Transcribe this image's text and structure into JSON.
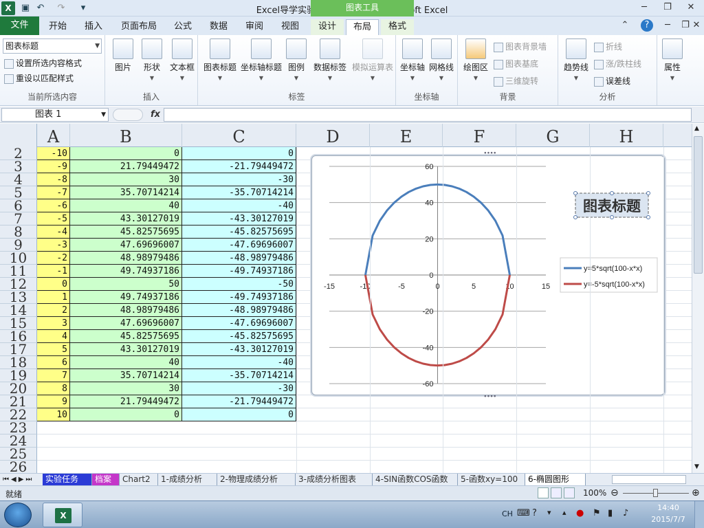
{
  "window": {
    "title": "Excel导学实验12-图表应用1  -  Microsoft Excel",
    "context_group": "图表工具",
    "quick_access": [
      "save-icon",
      "undo-icon",
      "redo-icon",
      "customize-icon"
    ]
  },
  "tabs": {
    "file": "文件",
    "items": [
      "开始",
      "插入",
      "页面布局",
      "公式",
      "数据",
      "审阅",
      "视图",
      "设计",
      "布局",
      "格式"
    ],
    "active": "布局"
  },
  "ribbon": {
    "current_selection": {
      "combo_value": "图表标题",
      "format_selection": "设置所选内容格式",
      "reset_style": "重设以匹配样式",
      "label": "当前所选内容"
    },
    "insert": {
      "picture": "图片",
      "shapes": "形状",
      "textbox": "文本框",
      "label": "插入"
    },
    "labels": {
      "chart_title": "图表标题",
      "axis_title": "坐标轴标题",
      "legend": "图例",
      "data_labels": "数据标签",
      "data_table": "模拟运算表",
      "label": "标签"
    },
    "axes": {
      "axes": "坐标轴",
      "gridlines": "网格线",
      "label": "坐标轴"
    },
    "background": {
      "plot_area": "绘图区",
      "chart_wall": "图表背景墙",
      "chart_floor": "图表基底",
      "rotation": "三维旋转",
      "label": "背景"
    },
    "analysis": {
      "trendline": "趋势线",
      "lines": "折线",
      "updown": "涨/跌柱线",
      "errorbars": "误差线",
      "label": "分析"
    },
    "properties": {
      "label": "属性"
    }
  },
  "formula_bar": {
    "name_box": "图表 1",
    "fx": "fx",
    "content": ""
  },
  "sheet": {
    "columns": [
      "A",
      "B",
      "C",
      "D",
      "E",
      "F",
      "G",
      "H"
    ],
    "rows": [
      {
        "n": "2",
        "a": "-10",
        "b": "0",
        "c": "0"
      },
      {
        "n": "3",
        "a": "-9",
        "b": "21.79449472",
        "c": "-21.79449472"
      },
      {
        "n": "4",
        "a": "-8",
        "b": "30",
        "c": "-30"
      },
      {
        "n": "5",
        "a": "-7",
        "b": "35.70714214",
        "c": "-35.70714214"
      },
      {
        "n": "6",
        "a": "-6",
        "b": "40",
        "c": "-40"
      },
      {
        "n": "7",
        "a": "-5",
        "b": "43.30127019",
        "c": "-43.30127019"
      },
      {
        "n": "8",
        "a": "-4",
        "b": "45.82575695",
        "c": "-45.82575695"
      },
      {
        "n": "9",
        "a": "-3",
        "b": "47.69696007",
        "c": "-47.69696007"
      },
      {
        "n": "10",
        "a": "-2",
        "b": "48.98979486",
        "c": "-48.98979486"
      },
      {
        "n": "11",
        "a": "-1",
        "b": "49.74937186",
        "c": "-49.74937186"
      },
      {
        "n": "12",
        "a": "0",
        "b": "50",
        "c": "-50"
      },
      {
        "n": "13",
        "a": "1",
        "b": "49.74937186",
        "c": "-49.74937186"
      },
      {
        "n": "14",
        "a": "2",
        "b": "48.98979486",
        "c": "-48.98979486"
      },
      {
        "n": "15",
        "a": "3",
        "b": "47.69696007",
        "c": "-47.69696007"
      },
      {
        "n": "16",
        "a": "4",
        "b": "45.82575695",
        "c": "-45.82575695"
      },
      {
        "n": "17",
        "a": "5",
        "b": "43.30127019",
        "c": "-43.30127019"
      },
      {
        "n": "18",
        "a": "6",
        "b": "40",
        "c": "-40"
      },
      {
        "n": "19",
        "a": "7",
        "b": "35.70714214",
        "c": "-35.70714214"
      },
      {
        "n": "20",
        "a": "8",
        "b": "30",
        "c": "-30"
      },
      {
        "n": "21",
        "a": "9",
        "b": "21.79449472",
        "c": "-21.79449472"
      },
      {
        "n": "22",
        "a": "10",
        "b": "0",
        "c": "0"
      },
      {
        "n": "23",
        "a": "",
        "b": "",
        "c": ""
      },
      {
        "n": "24",
        "a": "",
        "b": "",
        "c": ""
      },
      {
        "n": "25",
        "a": "",
        "b": "",
        "c": ""
      },
      {
        "n": "26",
        "a": "",
        "b": "",
        "c": ""
      }
    ]
  },
  "chart_data": {
    "type": "line",
    "title": "图表标题",
    "xlim": [
      -15,
      15
    ],
    "ylim": [
      -60,
      60
    ],
    "x_ticks": [
      -15,
      -10,
      -5,
      0,
      5,
      10,
      15
    ],
    "y_ticks": [
      -60,
      -40,
      -20,
      0,
      20,
      40,
      60
    ],
    "grid": true,
    "legend_position": "right",
    "x": [
      -10,
      -9,
      -8,
      -7,
      -6,
      -5,
      -4,
      -3,
      -2,
      -1,
      0,
      1,
      2,
      3,
      4,
      5,
      6,
      7,
      8,
      9,
      10
    ],
    "series": [
      {
        "name": "y=5*sqrt(100-x*x)",
        "color": "#4a7ebb",
        "values": [
          0,
          21.79449472,
          30,
          35.70714214,
          40,
          43.30127019,
          45.82575695,
          47.69696007,
          48.98979486,
          49.74937186,
          50,
          49.74937186,
          48.98979486,
          47.69696007,
          45.82575695,
          43.30127019,
          40,
          35.70714214,
          30,
          21.79449472,
          0
        ]
      },
      {
        "name": "y=-5*sqrt(100-x*x)",
        "color": "#be4b48",
        "values": [
          0,
          -21.79449472,
          -30,
          -35.70714214,
          -40,
          -43.30127019,
          -45.82575695,
          -47.69696007,
          -48.98979486,
          -49.74937186,
          -50,
          -49.74937186,
          -48.98979486,
          -47.69696007,
          -45.82575695,
          -43.30127019,
          -40,
          -35.70714214,
          -30,
          -21.79449472,
          0
        ]
      }
    ]
  },
  "sheet_tabs": {
    "items": [
      "实验任务",
      "档案",
      "Chart2",
      "1-成绩分析",
      "2-物理成绩分析",
      "3-成绩分析图表",
      "4-SIN函数COS函数",
      "5-函数xy=100",
      "6-椭圆图形"
    ],
    "active": "6-椭圆图形"
  },
  "statusbar": {
    "mode": "就绪",
    "zoom": "100%"
  },
  "taskbar": {
    "ime": "CH",
    "time": "14:40",
    "date": "2015/7/7"
  }
}
